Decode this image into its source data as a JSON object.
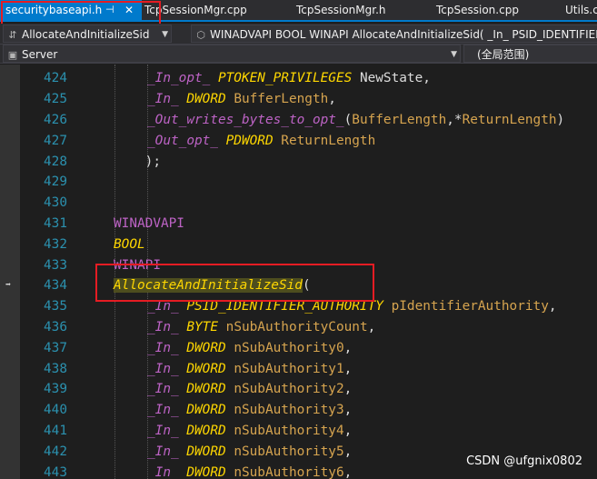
{
  "tabs": [
    {
      "label": "securitybaseapi.h",
      "active": true
    },
    {
      "label": "TcpSessionMgr.cpp"
    },
    {
      "label": "TcpSessionMgr.h"
    },
    {
      "label": "TcpSession.cpp"
    },
    {
      "label": "Utils.c"
    }
  ],
  "tab_pin_glyph": "⊣",
  "tab_close_glyph": "✕",
  "nav": {
    "scope_dropdown": "AllocateAndInitializeSid",
    "signature": "WINADVAPI BOOL WINAPI AllocateAndInitializeSid( _In_ PSID_IDENTIFIER_AUTHORITY",
    "project_dropdown": "Server",
    "global_scope": "(全局范围)"
  },
  "code": [
    {
      "num": "424",
      "parts": [
        [
          "sal",
          "_In_opt_ "
        ],
        [
          "ty",
          "PTOKEN_PRIVILEGES "
        ],
        [
          "dim",
          "NewState,"
        ]
      ]
    },
    {
      "num": "425",
      "parts": [
        [
          "sal",
          "_In_ "
        ],
        [
          "ty",
          "DWORD "
        ],
        [
          "par",
          "BufferLength"
        ],
        [
          "dim",
          ","
        ]
      ]
    },
    {
      "num": "426",
      "parts": [
        [
          "sal",
          "_Out_writes_bytes_to_opt_"
        ],
        [
          "dim",
          "("
        ],
        [
          "par",
          "BufferLength"
        ],
        [
          "dim",
          ",*"
        ],
        [
          "par",
          "ReturnLength"
        ],
        [
          "dim",
          ")"
        ]
      ]
    },
    {
      "num": "427",
      "parts": [
        [
          "sal",
          "_Out_opt_ "
        ],
        [
          "ty",
          "PDWORD "
        ],
        [
          "par",
          "ReturnLength"
        ]
      ]
    },
    {
      "num": "428",
      "parts": [
        [
          "dim",
          "    );"
        ]
      ]
    },
    {
      "num": "429",
      "parts": []
    },
    {
      "num": "430",
      "parts": []
    },
    {
      "num": "431",
      "parts": [
        [
          "mac",
          "WINADVAPI"
        ]
      ]
    },
    {
      "num": "432",
      "parts": [
        [
          "ty",
          "BOOL"
        ]
      ]
    },
    {
      "num": "433",
      "parts": [
        [
          "mac",
          "WINAPI"
        ]
      ]
    },
    {
      "num": "434",
      "parts": [
        [
          "hl",
          "AllocateAndInitializeSid"
        ],
        [
          "dim",
          "("
        ]
      ]
    },
    {
      "num": "435",
      "parts": [
        [
          "sal",
          "_In_ "
        ],
        [
          "ty",
          "PSID_IDENTIFIER_AUTHORITY "
        ],
        [
          "par",
          "pIdentifierAuthority"
        ],
        [
          "dim",
          ","
        ]
      ]
    },
    {
      "num": "436",
      "parts": [
        [
          "sal",
          "_In_ "
        ],
        [
          "ty",
          "BYTE "
        ],
        [
          "par",
          "nSubAuthorityCount"
        ],
        [
          "dim",
          ","
        ]
      ]
    },
    {
      "num": "437",
      "parts": [
        [
          "sal",
          "_In_ "
        ],
        [
          "ty",
          "DWORD "
        ],
        [
          "par",
          "nSubAuthority0"
        ],
        [
          "dim",
          ","
        ]
      ]
    },
    {
      "num": "438",
      "parts": [
        [
          "sal",
          "_In_ "
        ],
        [
          "ty",
          "DWORD "
        ],
        [
          "par",
          "nSubAuthority1"
        ],
        [
          "dim",
          ","
        ]
      ]
    },
    {
      "num": "439",
      "parts": [
        [
          "sal",
          "_In_ "
        ],
        [
          "ty",
          "DWORD "
        ],
        [
          "par",
          "nSubAuthority2"
        ],
        [
          "dim",
          ","
        ]
      ]
    },
    {
      "num": "440",
      "parts": [
        [
          "sal",
          "_In_ "
        ],
        [
          "ty",
          "DWORD "
        ],
        [
          "par",
          "nSubAuthority3"
        ],
        [
          "dim",
          ","
        ]
      ]
    },
    {
      "num": "441",
      "parts": [
        [
          "sal",
          "_In_ "
        ],
        [
          "ty",
          "DWORD "
        ],
        [
          "par",
          "nSubAuthority4"
        ],
        [
          "dim",
          ","
        ]
      ]
    },
    {
      "num": "442",
      "parts": [
        [
          "sal",
          "_In_ "
        ],
        [
          "ty",
          "DWORD "
        ],
        [
          "par",
          "nSubAuthority5"
        ],
        [
          "dim",
          ","
        ]
      ]
    },
    {
      "num": "443",
      "parts": [
        [
          "sal",
          "_In_ "
        ],
        [
          "ty",
          "DWORD "
        ],
        [
          "par",
          "nSubAuthority6"
        ],
        [
          "dim",
          ","
        ]
      ]
    }
  ],
  "watermark": "CSDN @ufgnix0802"
}
